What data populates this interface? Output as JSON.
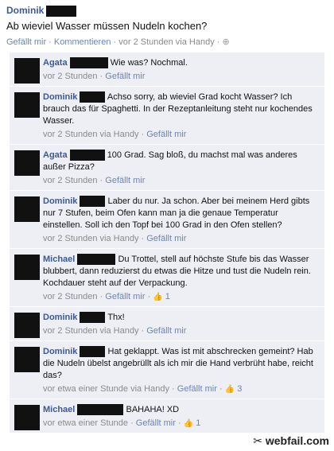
{
  "post": {
    "author": "Dominik",
    "text": "Ab wieviel Wasser müssen Nudeln kochen?",
    "like_label": "Gefällt mir",
    "comment_label": "Kommentieren",
    "time": "vor 2 Stunden via Handy"
  },
  "comments": [
    {
      "author": "Agata",
      "text": "Wie was? Nochmal.",
      "time": "vor 2 Stunden",
      "like_label": "Gefällt mir",
      "likes": ""
    },
    {
      "author": "Dominik",
      "text": "Achso sorry, ab wieviel Grad kocht Wasser? Ich brauch das für Spaghetti. In der Rezeptanleitung steht nur kochendes Wasser.",
      "time": "vor 2 Stunden via Handy",
      "like_label": "Gefällt mir",
      "likes": ""
    },
    {
      "author": "Agata",
      "text": "100 Grad. Sag bloß, du machst mal was anderes außer Pizza?",
      "time": "vor 2 Stunden",
      "like_label": "Gefällt mir",
      "likes": ""
    },
    {
      "author": "Dominik",
      "text": "Laber du nur. Ja schon. Aber bei meinem Herd gibts nur 7 Stufen, beim Ofen kann man ja die genaue Temperatur einstellen. Soll ich den Topf bei 100 Grad in den Ofen stellen?",
      "time": "vor 2 Stunden via Handy",
      "like_label": "Gefällt mir",
      "likes": ""
    },
    {
      "author": "Michael",
      "text": "Du Trottel, stell auf höchste Stufe bis das Wasser blubbert, dann reduzierst du etwas die Hitze und tust die Nudeln rein. Kochdauer steht auf der Verpackung.",
      "time": "vor 2 Stunden",
      "like_label": "Gefällt mir",
      "likes": "1"
    },
    {
      "author": "Dominik",
      "text": "Thx!",
      "time": "vor 2 Stunden via Handy",
      "like_label": "Gefällt mir",
      "likes": ""
    },
    {
      "author": "Dominik",
      "text": "Hat geklappt. Was ist mit abschrecken gemeint? Hab die Nudeln übelst angebrüllt als ich mir die Hand verbrüht habe, reicht das?",
      "time": "vor etwa einer Stunde via Handy",
      "like_label": "Gefällt mir",
      "likes": "3"
    },
    {
      "author": "Michael",
      "text": "BAHAHA! XD",
      "time": "vor etwa einer Stunde",
      "like_label": "Gefällt mir",
      "likes": "1"
    }
  ],
  "watermark": "webfail.com"
}
